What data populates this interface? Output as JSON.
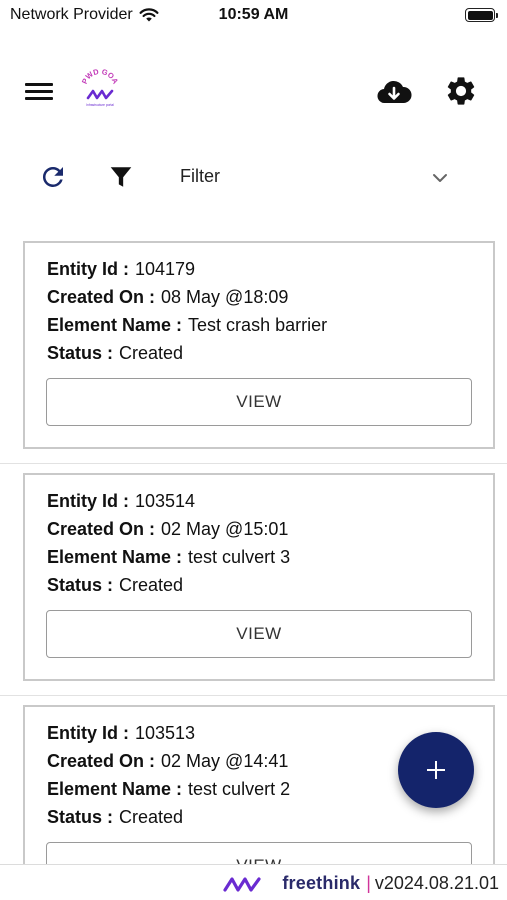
{
  "status_bar": {
    "carrier": "Network Provider",
    "time": "10:59 AM"
  },
  "header": {
    "logo_text": "PWD GOA",
    "logo_subtext": "Infrastructure portal"
  },
  "filter": {
    "label": "Filter"
  },
  "cards": [
    {
      "entity_id_label": "Entity Id :",
      "entity_id": "104179",
      "created_on_label": "Created On :",
      "created_on": "08 May @18:09",
      "element_name_label": "Element Name :",
      "element_name": "Test crash barrier",
      "status_label": "Status :",
      "status": "Created",
      "view_label": "VIEW"
    },
    {
      "entity_id_label": "Entity Id :",
      "entity_id": "103514",
      "created_on_label": "Created On :",
      "created_on": "02 May @15:01",
      "element_name_label": "Element Name :",
      "element_name": "test culvert 3",
      "status_label": "Status :",
      "status": "Created",
      "view_label": "VIEW"
    },
    {
      "entity_id_label": "Entity Id :",
      "entity_id": "103513",
      "created_on_label": "Created On :",
      "created_on": "02 May @14:41",
      "element_name_label": "Element Name :",
      "element_name": "test culvert 2",
      "status_label": "Status :",
      "status": "Created",
      "view_label": "VIEW"
    }
  ],
  "footer": {
    "brand": "freethink",
    "separator": "|",
    "version": "v2024.08.21.01"
  },
  "colors": {
    "fab": "#14246b",
    "refresh_icon": "#1a2a6c",
    "brand_accent": "#d0349a",
    "brand_purple": "#6a2bd1"
  },
  "icons": {
    "menu": "hamburger-icon",
    "cloud": "cloud-download-icon",
    "settings": "gear-icon",
    "refresh": "refresh-icon",
    "filter": "funnel-icon",
    "dropdown": "chevron-down-icon",
    "add": "plus-icon"
  }
}
